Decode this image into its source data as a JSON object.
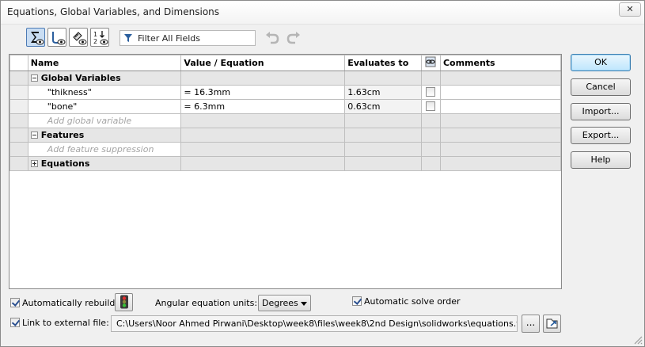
{
  "window": {
    "title": "Equations, Global Variables, and Dimensions",
    "close_glyph": "✕"
  },
  "toolbar": {
    "buttons": [
      {
        "name": "equation-view",
        "icon": "sigma-eye-icon",
        "active": true
      },
      {
        "name": "sketch-equation-view",
        "icon": "sketch-eye-icon",
        "active": false
      },
      {
        "name": "dimension-view",
        "icon": "dimension-eye-icon",
        "active": false
      },
      {
        "name": "ordered-view",
        "icon": "sort-order-eye-icon",
        "active": false
      }
    ],
    "filter_placeholder": "Filter All Fields",
    "undo_icon": "undo-icon",
    "redo_icon": "redo-icon"
  },
  "grid": {
    "columns": {
      "name": "Name",
      "value": "Value / Equation",
      "evaluates": "Evaluates to",
      "suppress_icon": "suppress-link-icon",
      "comments": "Comments"
    },
    "sections": {
      "global": {
        "label": "Global Variables",
        "variables": [
          {
            "name": "\"thikness\"",
            "value": "= 16.3mm",
            "evaluates": "1.63cm",
            "checked": false,
            "comment": ""
          },
          {
            "name": "\"bone\"",
            "value": "= 6.3mm",
            "evaluates": "0.63cm",
            "checked": false,
            "comment": ""
          }
        ],
        "add_placeholder": "Add global variable"
      },
      "features": {
        "label": "Features",
        "add_placeholder": "Add feature suppression"
      },
      "equations": {
        "label": "Equations"
      }
    }
  },
  "buttons": {
    "ok": "OK",
    "cancel": "Cancel",
    "import": "Import...",
    "export": "Export...",
    "help": "Help"
  },
  "options": {
    "auto_rebuild": {
      "label": "Automatically rebuild",
      "checked": true
    },
    "rebuild_icon": "traffic-light-icon",
    "angular_units_label": "Angular equation units:",
    "angular_units_value": "Degrees",
    "auto_solve": {
      "label": "Automatic solve order",
      "checked": true
    },
    "link_external": {
      "label": "Link to external file:",
      "checked": true
    },
    "file_path": "C:\\Users\\Noor Ahmed Pirwani\\Desktop\\week8\\files\\week8\\2nd Design\\solidworks\\equations.txt",
    "browse_label": "...",
    "open_file_icon": "open-file-icon"
  }
}
